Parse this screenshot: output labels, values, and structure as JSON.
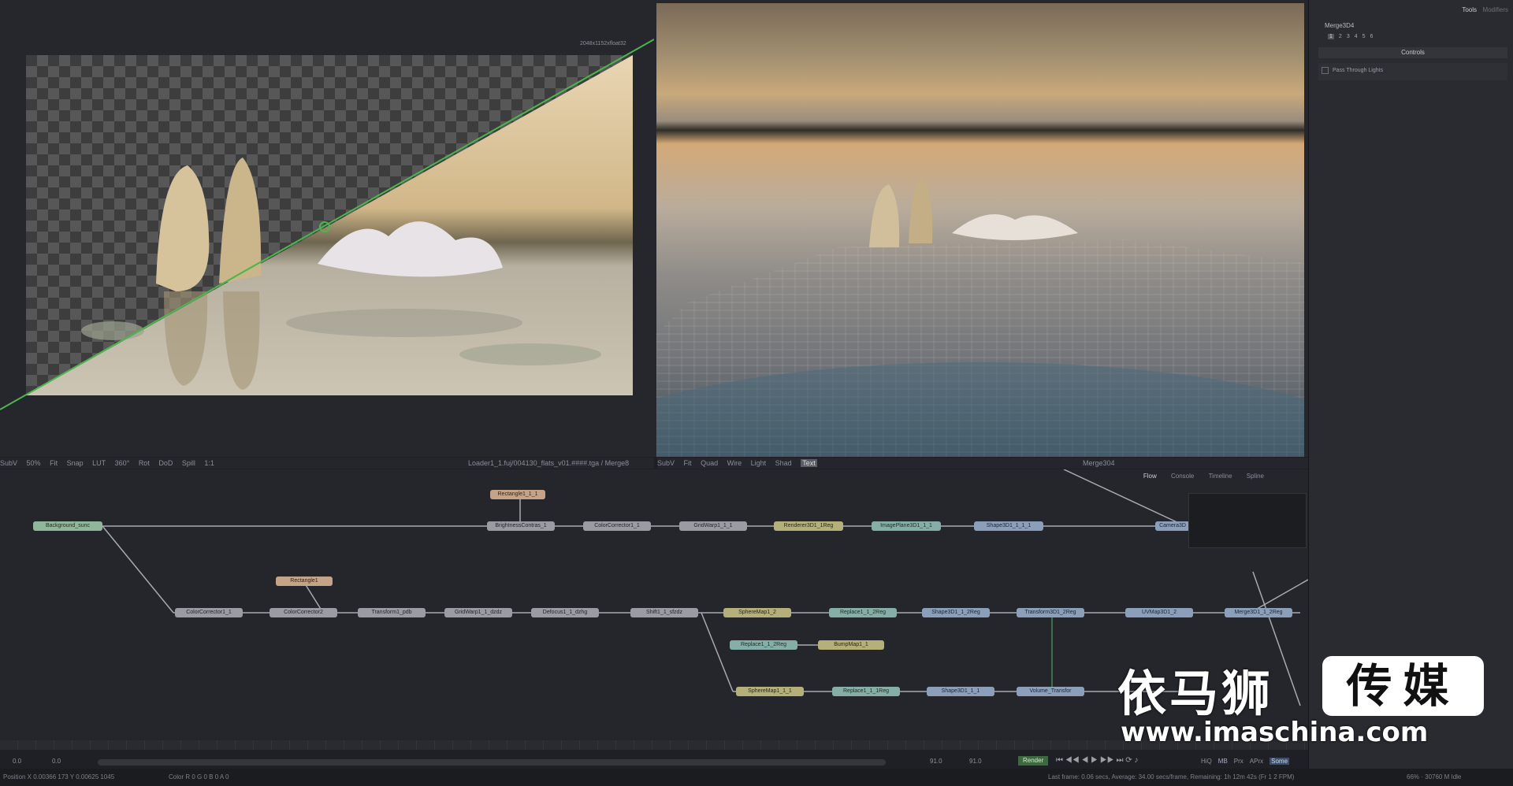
{
  "viewer_left": {
    "resolution": "2048x1152xfloat32",
    "toolbar": [
      "SubV",
      "50%",
      "Fit",
      "Snap",
      "LUT",
      "360°",
      "Rot",
      "DoD",
      "Spill",
      "1:1"
    ]
  },
  "viewer_center_toolbar": {
    "path": "Loader1_1.fuj/004130_flats_v01.####.tga / Merge8",
    "items": [
      "SubV",
      "Fit",
      "Quad",
      "Wire",
      "Light",
      "Shad",
      "Text"
    ]
  },
  "viewer_right_title": "Merge304",
  "inspector": {
    "tabs": [
      "Tools",
      "Modifiers"
    ],
    "node_name": "Merge3D4",
    "version_buttons": [
      "1",
      "2",
      "3",
      "4",
      "5",
      "6"
    ],
    "section": "Controls",
    "checkbox_label": "Pass Through Lights"
  },
  "node_editor": {
    "tabs": [
      "Flow",
      "Console",
      "Timeline",
      "Spline"
    ],
    "nodes": [
      {
        "label": "Background_sunc",
        "color": "green"
      },
      {
        "label": "Rectangle1_1_1",
        "color": "tan"
      },
      {
        "label": "BrightnessContras_1",
        "color": "grey"
      },
      {
        "label": "ColorCorrector1_1",
        "color": "grey"
      },
      {
        "label": "GridWarp1_1_1",
        "color": "grey"
      },
      {
        "label": "Renderer3D1_1Reg",
        "color": "yellow"
      },
      {
        "label": "ImagePlane3D1_1_1",
        "color": "teal"
      },
      {
        "label": "Shape3D1_1_1_1",
        "color": "blue"
      },
      {
        "label": "Camera3D",
        "color": "blue"
      },
      {
        "label": "Rectangle1",
        "color": "tan"
      },
      {
        "label": "ColorCorrector1_1",
        "color": "grey"
      },
      {
        "label": "ColorCorrector2",
        "color": "grey"
      },
      {
        "label": "Transform1_pdb",
        "color": "grey"
      },
      {
        "label": "GridWarp1_1_dzdz",
        "color": "grey"
      },
      {
        "label": "Defocus1_1_dzhg",
        "color": "grey"
      },
      {
        "label": "Shift1_1_sfzdz",
        "color": "grey"
      },
      {
        "label": "SphereMap1_2",
        "color": "yellow"
      },
      {
        "label": "Replace1_1_2Reg",
        "color": "teal"
      },
      {
        "label": "Shape3D1_1_2Reg",
        "color": "blue"
      },
      {
        "label": "Transform3D1_2Reg",
        "color": "blue"
      },
      {
        "label": "UVMap3D1_2",
        "color": "blue"
      },
      {
        "label": "Merge3D1_1_2Reg",
        "color": "blue"
      },
      {
        "label": "Replace1_1_2Reg",
        "color": "teal"
      },
      {
        "label": "BumpMap1_1",
        "color": "yellow"
      },
      {
        "label": "SphereMap1_1_1",
        "color": "yellow"
      },
      {
        "label": "Replace1_1_1Reg",
        "color": "teal"
      },
      {
        "label": "Shape3D1_1_1",
        "color": "blue"
      },
      {
        "label": "Volume_Transfor",
        "color": "blue"
      }
    ]
  },
  "timeline": {
    "start": "0.0",
    "end": "0.0",
    "current_a": "91.0",
    "current_b": "91.0",
    "render_label": "Render",
    "hiq": "HiQ",
    "mb": "MB",
    "prx": "Prx",
    "aprx": "APrx",
    "some": "Some"
  },
  "statusbar": {
    "position": "Position  X 0.00366  173  Y 0.00625  1045",
    "color": "Color  R 0    G 0    B 0    A 0",
    "render_stats": "Last frame: 0.06 secs, Average: 34.00 secs/frame, Remaining: 1h 12m 42s (Fr 1 2 FPM)",
    "memory": "66% · 30760 M   Idle"
  },
  "watermark": {
    "chinese": "依马狮",
    "chinese_box": "传媒",
    "url": "www.imaschina.com"
  }
}
